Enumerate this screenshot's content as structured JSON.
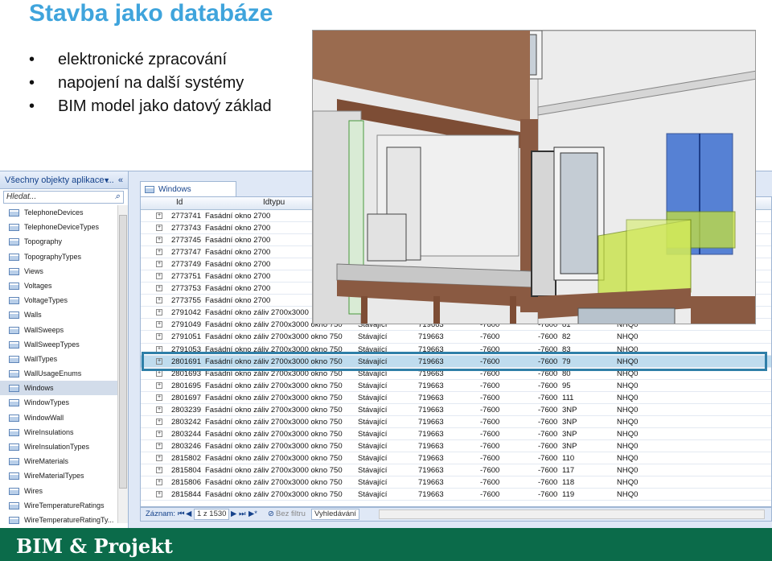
{
  "slide": {
    "title": "Stavba jako databáze",
    "bullets": [
      "elektronické zpracování",
      "napojení na další systémy",
      "BIM model jako datový základ"
    ]
  },
  "nav_pane": {
    "header": "Všechny objekty aplikace ...",
    "dropdown_icon": "chevron-down-icon",
    "collapse_icon": "double-chevron-left-icon",
    "search_placeholder": "Hledat...",
    "items": [
      {
        "label": "TelephoneDevices",
        "selected": false
      },
      {
        "label": "TelephoneDeviceTypes",
        "selected": false
      },
      {
        "label": "Topography",
        "selected": false
      },
      {
        "label": "TopographyTypes",
        "selected": false
      },
      {
        "label": "Views",
        "selected": false
      },
      {
        "label": "Voltages",
        "selected": false
      },
      {
        "label": "VoltageTypes",
        "selected": false
      },
      {
        "label": "Walls",
        "selected": false
      },
      {
        "label": "WallSweeps",
        "selected": false
      },
      {
        "label": "WallSweepTypes",
        "selected": false
      },
      {
        "label": "WallTypes",
        "selected": false
      },
      {
        "label": "WallUsageEnums",
        "selected": false
      },
      {
        "label": "Windows",
        "selected": true
      },
      {
        "label": "WindowTypes",
        "selected": false
      },
      {
        "label": "WindowWall",
        "selected": false
      },
      {
        "label": "WireInsulations",
        "selected": false
      },
      {
        "label": "WireInsulationTypes",
        "selected": false
      },
      {
        "label": "WireMaterials",
        "selected": false
      },
      {
        "label": "WireMaterialTypes",
        "selected": false
      },
      {
        "label": "Wires",
        "selected": false
      },
      {
        "label": "WireTemperatureRatings",
        "selected": false
      },
      {
        "label": "WireTemperatureRatingTy...",
        "selected": false
      }
    ]
  },
  "table": {
    "tab_title": "Windows",
    "columns": [
      "Id",
      "Idtypu"
    ],
    "rows": [
      {
        "id": "2773741",
        "type": "Fasádní okno 2700",
        "status": "",
        "c1": "",
        "c2": "",
        "c3": "",
        "level": "",
        "nh": ""
      },
      {
        "id": "2773743",
        "type": "Fasádní okno 2700",
        "status": "",
        "c1": "",
        "c2": "",
        "c3": "",
        "level": "",
        "nh": ""
      },
      {
        "id": "2773745",
        "type": "Fasádní okno 2700",
        "status": "",
        "c1": "",
        "c2": "",
        "c3": "",
        "level": "",
        "nh": ""
      },
      {
        "id": "2773747",
        "type": "Fasádní okno 2700",
        "status": "",
        "c1": "",
        "c2": "",
        "c3": "",
        "level": "",
        "nh": ""
      },
      {
        "id": "2773749",
        "type": "Fasádní okno 2700",
        "status": "",
        "c1": "",
        "c2": "",
        "c3": "",
        "level": "",
        "nh": ""
      },
      {
        "id": "2773751",
        "type": "Fasádní okno 2700",
        "status": "",
        "c1": "",
        "c2": "",
        "c3": "",
        "level": "",
        "nh": ""
      },
      {
        "id": "2773753",
        "type": "Fasádní okno 2700",
        "status": "",
        "c1": "",
        "c2": "",
        "c3": "",
        "level": "",
        "nh": ""
      },
      {
        "id": "2773755",
        "type": "Fasádní okno 2700",
        "status": "",
        "c1": "",
        "c2": "",
        "c3": "",
        "level": "",
        "nh": ""
      },
      {
        "id": "2791042",
        "type": "Fasádní okno záliv 2700x3000",
        "status": "",
        "c1": "",
        "c2": "",
        "c3": "",
        "level": "",
        "nh": ""
      },
      {
        "id": "2791049",
        "type": "Fasádní okno záliv 2700x3000 okno 750",
        "status": "Stávající",
        "c1": "719663",
        "c2": "-7600",
        "c3": "-7600",
        "level": "81",
        "nh": "NHQ0"
      },
      {
        "id": "2791051",
        "type": "Fasádní okno záliv 2700x3000 okno 750",
        "status": "Stávající",
        "c1": "719663",
        "c2": "-7600",
        "c3": "-7600",
        "level": "82",
        "nh": "NHQ0"
      },
      {
        "id": "2791053",
        "type": "Fasádní okno záliv 2700x3000 okno 750",
        "status": "Stávající",
        "c1": "719663",
        "c2": "-7600",
        "c3": "-7600",
        "level": "83",
        "nh": "NHQ0"
      },
      {
        "id": "2801691",
        "type": "Fasádní okno záliv 2700x3000 okno 750",
        "status": "Stávající",
        "c1": "719663",
        "c2": "-7600",
        "c3": "-7600",
        "level": "79",
        "nh": "NHQ0"
      },
      {
        "id": "2801693",
        "type": "Fasádní okno záliv 2700x3000 okno 750",
        "status": "Stávající",
        "c1": "719663",
        "c2": "-7600",
        "c3": "-7600",
        "level": "80",
        "nh": "NHQ0"
      },
      {
        "id": "2801695",
        "type": "Fasádní okno záliv 2700x3000 okno 750",
        "status": "Stávající",
        "c1": "719663",
        "c2": "-7600",
        "c3": "-7600",
        "level": "95",
        "nh": "NHQ0"
      },
      {
        "id": "2801697",
        "type": "Fasádní okno záliv 2700x3000 okno 750",
        "status": "Stávající",
        "c1": "719663",
        "c2": "-7600",
        "c3": "-7600",
        "level": "111",
        "nh": "NHQ0"
      },
      {
        "id": "2803239",
        "type": "Fasádní okno záliv 2700x3000 okno 750",
        "status": "Stávající",
        "c1": "719663",
        "c2": "-7600",
        "c3": "-7600",
        "level": "3NP",
        "nh": "NHQ0"
      },
      {
        "id": "2803242",
        "type": "Fasádní okno záliv 2700x3000 okno 750",
        "status": "Stávající",
        "c1": "719663",
        "c2": "-7600",
        "c3": "-7600",
        "level": "3NP",
        "nh": "NHQ0"
      },
      {
        "id": "2803244",
        "type": "Fasádní okno záliv 2700x3000 okno 750",
        "status": "Stávající",
        "c1": "719663",
        "c2": "-7600",
        "c3": "-7600",
        "level": "3NP",
        "nh": "NHQ0"
      },
      {
        "id": "2803246",
        "type": "Fasádní okno záliv 2700x3000 okno 750",
        "status": "Stávající",
        "c1": "719663",
        "c2": "-7600",
        "c3": "-7600",
        "level": "3NP",
        "nh": "NHQ0"
      },
      {
        "id": "2815802",
        "type": "Fasádní okno záliv 2700x3000 okno 750",
        "status": "Stávající",
        "c1": "719663",
        "c2": "-7600",
        "c3": "-7600",
        "level": "110",
        "nh": "NHQ0"
      },
      {
        "id": "2815804",
        "type": "Fasádní okno záliv 2700x3000 okno 750",
        "status": "Stávající",
        "c1": "719663",
        "c2": "-7600",
        "c3": "-7600",
        "level": "117",
        "nh": "NHQ0"
      },
      {
        "id": "2815806",
        "type": "Fasádní okno záliv 2700x3000 okno 750",
        "status": "Stávající",
        "c1": "719663",
        "c2": "-7600",
        "c3": "-7600",
        "level": "118",
        "nh": "NHQ0"
      },
      {
        "id": "2815844",
        "type": "Fasádní okno záliv 2700x3000 okno 750",
        "status": "Stávající",
        "c1": "719663",
        "c2": "-7600",
        "c3": "-7600",
        "level": "119",
        "nh": "NHQ0"
      }
    ],
    "selected_row_id": "2801691"
  },
  "record_nav": {
    "label": "Záznam:",
    "position": "1 z 1530",
    "filter": "Bez filtru",
    "search": "Vyhledávání"
  },
  "footer": {
    "brand": "BIM & Projekt"
  },
  "colors": {
    "title": "#3fa4dc",
    "footer_bg": "#0b6b4a",
    "selection_border": "#2f7fa8",
    "glass_green": "#c6e23c",
    "glass_blue": "#3d6fd0"
  }
}
